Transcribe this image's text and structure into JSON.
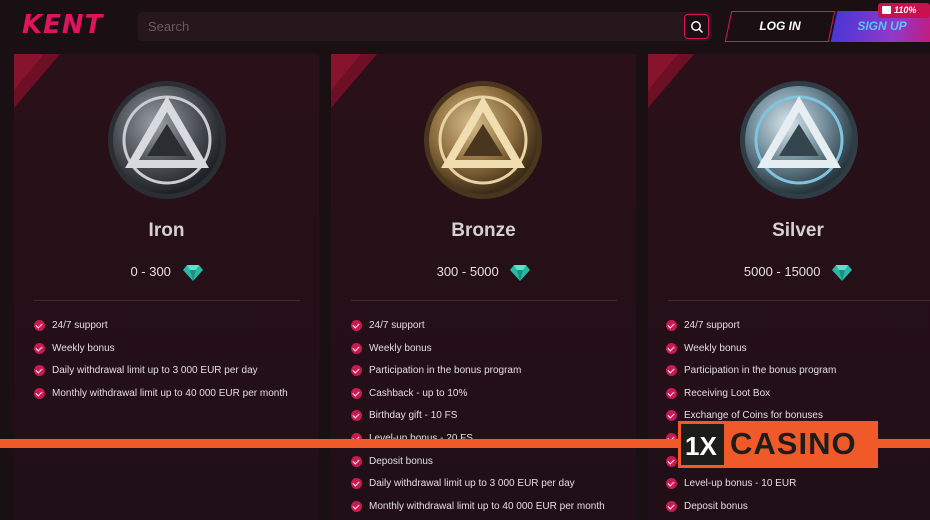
{
  "header": {
    "logo": "KENT",
    "search_placeholder": "Search",
    "login_label": "LOG IN",
    "signup_label": "SIGN UP",
    "bonus_badge": "110%"
  },
  "tiers": [
    {
      "name": "Iron",
      "range": "0 - 300",
      "perks": [
        "24/7 support",
        "Weekly bonus",
        "Daily withdrawal limit up to 3 000 EUR per day",
        "Monthly withdrawal limit up to 40 000 EUR per month"
      ]
    },
    {
      "name": "Bronze",
      "range": "300 - 5000",
      "perks": [
        "24/7 support",
        "Weekly bonus",
        "Participation in the bonus program",
        "Cashback - up to 10%",
        "Birthday gift - 10 FS",
        "Level-up bonus - 20 FS",
        "Deposit bonus",
        "Daily withdrawal limit up to 3 000 EUR per day",
        "Monthly withdrawal limit up to 40 000 EUR per month"
      ]
    },
    {
      "name": "Silver",
      "range": "5000 - 15000",
      "perks": [
        "24/7 support",
        "Weekly bonus",
        "Participation in the bonus program",
        "Receiving Loot Box",
        "Exchange of Coins for bonuses",
        "",
        "",
        "Level-up bonus - 10 EUR",
        "Deposit bonus"
      ]
    }
  ],
  "watermark": {
    "logo_mark": "1X",
    "text": "CASINO"
  },
  "colors": {
    "accent": "#e0145a",
    "background": "#1a0f13",
    "watermark": "#f05a28"
  }
}
